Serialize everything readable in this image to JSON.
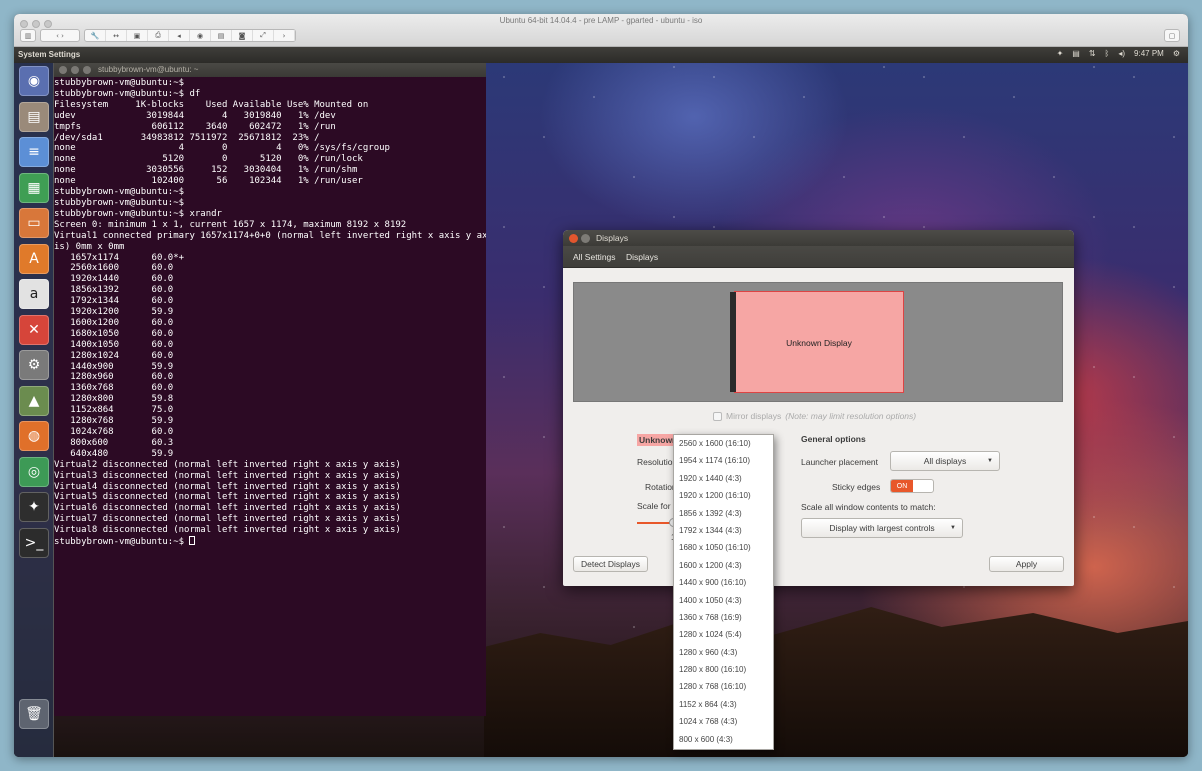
{
  "host": {
    "title": "Ubuntu 64-bit 14.04.4 - pre LAMP - gparted - ubuntu - iso",
    "toolbar_icons": [
      "sidebar-icon",
      "back-forward-icon",
      "wrench-icon",
      "resize-icon",
      "fit-icon",
      "print-icon",
      "sound-icon",
      "record-icon",
      "usb-icon",
      "camera-icon",
      "fullscreen-icon",
      "chevron-icon"
    ]
  },
  "topbar": {
    "title": "System Settings",
    "time": "9:47 PM",
    "tray_icons": [
      "dropbox-icon",
      "keyboard-icon",
      "network-icon",
      "bluetooth-icon",
      "volume-icon",
      "gear-icon"
    ]
  },
  "launcher": {
    "items": [
      {
        "name": "dash-icon",
        "glyph": "◉",
        "color": "#5a6fb0"
      },
      {
        "name": "files-icon",
        "glyph": "▤",
        "color": "#9a8a7a"
      },
      {
        "name": "writer-icon",
        "glyph": "≡",
        "color": "#5c8fd6"
      },
      {
        "name": "calc-icon",
        "glyph": "▦",
        "color": "#3f9e54"
      },
      {
        "name": "impress-icon",
        "glyph": "▭",
        "color": "#d8773a"
      },
      {
        "name": "software-center-icon",
        "glyph": "A",
        "color": "#e07a2a"
      },
      {
        "name": "amazon-icon",
        "glyph": "a",
        "color": "#e2e2e2"
      },
      {
        "name": "settings-tools-icon",
        "glyph": "✕",
        "color": "#d6453a"
      },
      {
        "name": "system-settings-icon",
        "glyph": "⚙",
        "color": "#7a7a7a"
      },
      {
        "name": "photos-icon",
        "glyph": "▲",
        "color": "#6b8c4f"
      },
      {
        "name": "firefox-icon",
        "glyph": "◍",
        "color": "#e0702a"
      },
      {
        "name": "chrome-icon",
        "glyph": "◎",
        "color": "#3d9a56"
      },
      {
        "name": "dark-app-icon",
        "glyph": "✦",
        "color": "#2e2e2e"
      },
      {
        "name": "terminal-icon",
        "glyph": ">_",
        "color": "#2c2c2c"
      },
      {
        "name": "trash-icon",
        "glyph": "🗑",
        "color": "#5e6470"
      }
    ]
  },
  "terminal": {
    "title": "stubbybrown-vm@ubuntu: ~",
    "lines": [
      "stubbybrown-vm@ubuntu:~$",
      "stubbybrown-vm@ubuntu:~$ df",
      "Filesystem     1K-blocks    Used Available Use% Mounted on",
      "udev             3019844       4   3019840   1% /dev",
      "tmpfs             606112    3640    602472   1% /run",
      "/dev/sda1       34983812 7511972  25671812  23% /",
      "none                   4       0         4   0% /sys/fs/cgroup",
      "none                5120       0      5120   0% /run/lock",
      "none             3030556     152   3030404   1% /run/shm",
      "none              102400      56    102344   1% /run/user",
      "stubbybrown-vm@ubuntu:~$",
      "stubbybrown-vm@ubuntu:~$",
      "stubbybrown-vm@ubuntu:~$ xrandr",
      "Screen 0: minimum 1 x 1, current 1657 x 1174, maximum 8192 x 8192",
      "Virtual1 connected primary 1657x1174+0+0 (normal left inverted right x axis y ax",
      "is) 0mm x 0mm",
      "   1657x1174      60.0*+",
      "   2560x1600      60.0",
      "   1920x1440      60.0",
      "   1856x1392      60.0",
      "   1792x1344      60.0",
      "   1920x1200      59.9",
      "   1600x1200      60.0",
      "   1680x1050      60.0",
      "   1400x1050      60.0",
      "   1280x1024      60.0",
      "   1440x900       59.9",
      "   1280x960       60.0",
      "   1360x768       60.0",
      "   1280x800       59.8",
      "   1152x864       75.0",
      "   1280x768       59.9",
      "   1024x768       60.0",
      "   800x600        60.3",
      "   640x480        59.9",
      "Virtual2 disconnected (normal left inverted right x axis y axis)",
      "Virtual3 disconnected (normal left inverted right x axis y axis)",
      "Virtual4 disconnected (normal left inverted right x axis y axis)",
      "Virtual5 disconnected (normal left inverted right x axis y axis)",
      "Virtual6 disconnected (normal left inverted right x axis y axis)",
      "Virtual7 disconnected (normal left inverted right x axis y axis)",
      "Virtual8 disconnected (normal left inverted right x axis y axis)"
    ],
    "prompt": "stubbybrown-vm@ubuntu:~$ "
  },
  "dialog": {
    "title": "Displays",
    "nav": {
      "all_settings": "All Settings",
      "displays": "Displays"
    },
    "monitor_label": "Unknown Display",
    "mirror_label": "Mirror displays",
    "mirror_note": "(Note: may limit resolution options)",
    "display_name": "Unknown Di",
    "resolution_label": "Resolution",
    "rotation_label": "Rotation",
    "scale_label": "Scale for me",
    "scale_value": "1",
    "general_options": "General options",
    "launcher_placement_label": "Launcher placement",
    "launcher_placement_value": "All displays",
    "sticky_edges_label": "Sticky edges",
    "sticky_edges_value": "ON",
    "scale_all_label": "Scale all window contents to match:",
    "scale_all_value": "Display with largest controls",
    "detect_button": "Detect Displays",
    "apply_button": "Apply"
  },
  "resolution_dropdown": {
    "options": [
      "2560 x 1600 (16:10)",
      "1954 x 1174 (16:10)",
      "1920 x 1440 (4:3)",
      "1920 x 1200 (16:10)",
      "1856 x 1392 (4:3)",
      "1792 x 1344 (4:3)",
      "1680 x 1050 (16:10)",
      "1600 x 1200 (4:3)",
      "1440 x 900 (16:10)",
      "1400 x 1050 (4:3)",
      "1360 x 768 (16:9)",
      "1280 x 1024 (5:4)",
      "1280 x 960 (4:3)",
      "1280 x 800 (16:10)",
      "1280 x 768 (16:10)",
      "1152 x 864 (4:3)",
      "1024 x 768 (4:3)",
      "800 x 600 (4:3)"
    ]
  },
  "colors": {
    "ubuntu_orange": "#e8572a",
    "terminal_bg": "#2c0a24",
    "monitor_fill": "#f6a6a4"
  }
}
